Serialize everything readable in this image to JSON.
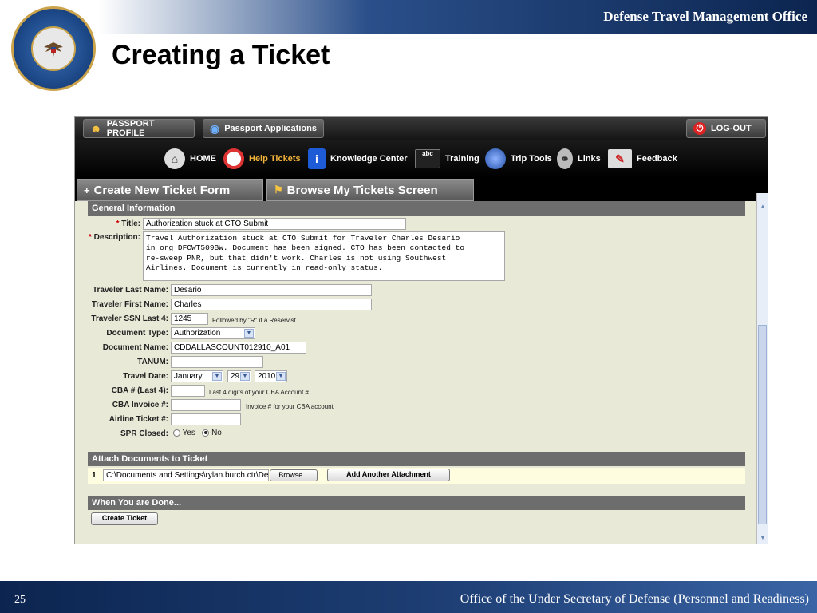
{
  "slide": {
    "org_name": "Defense Travel Management Office",
    "title": "Creating a Ticket",
    "page_number": "25",
    "footer": "Office of the Under Secretary of Defense (Personnel and Readiness)",
    "seal_text": [
      "Defense Travel Management Office",
      "Department of Defense"
    ]
  },
  "app": {
    "top_nav": {
      "passport_profile": "PASSPORT PROFILE",
      "passport_applications": "Passport Applications",
      "logout": "LOG-OUT"
    },
    "main_nav": [
      {
        "label": "HOME",
        "icon": "home-icon"
      },
      {
        "label": "Help Tickets",
        "icon": "lifebuoy-icon"
      },
      {
        "label": "Knowledge Center",
        "icon": "info-icon"
      },
      {
        "label": "Training",
        "icon": "terminal-icon"
      },
      {
        "label": "Trip Tools",
        "icon": "globe-icon"
      },
      {
        "label": "Links",
        "icon": "chain-icon"
      },
      {
        "label": "Feedback",
        "icon": "book-pencil-icon"
      }
    ],
    "terminal_icon_text": "abc",
    "tabs": {
      "create": "Create New Ticket Form",
      "browse": "Browse My Tickets Screen"
    },
    "sections": {
      "general": "General Information",
      "attach": "Attach Documents to Ticket",
      "done": "When You are Done..."
    },
    "form": {
      "title_label": "Title:",
      "title_value": "Authorization stuck at CTO Submit",
      "description_label": "Description:",
      "description_value": "Travel Authorization stuck at CTO Submit for Traveler Charles Desario\nin org DFCWT509BW. Document has been signed. CTO has been contacted to\nre-sweep PNR, but that didn't work. Charles is not using Southwest\nAirlines. Document is currently in read-only status.",
      "last_name_label": "Traveler Last Name:",
      "last_name_value": "Desario",
      "first_name_label": "Traveler First Name:",
      "first_name_value": "Charles",
      "ssn_label": "Traveler SSN Last 4:",
      "ssn_value": "1245",
      "ssn_hint": "Followed by \"R\" if a Reservist",
      "doc_type_label": "Document Type:",
      "doc_type_value": "Authorization",
      "doc_name_label": "Document Name:",
      "doc_name_value": "CDDALLASCOUNT012910_A01",
      "tanum_label": "TANUM:",
      "tanum_value": "",
      "travel_date_label": "Travel Date:",
      "travel_month": "January",
      "travel_day": "29",
      "travel_year": "2010",
      "cba_label": "CBA # (Last 4):",
      "cba_value": "",
      "cba_hint": "Last 4 digits of your CBA Account #",
      "cba_invoice_label": "CBA Invoice #:",
      "cba_invoice_value": "",
      "cba_invoice_hint": "Invoice # for your CBA account",
      "airline_label": "Airline Ticket #:",
      "airline_value": "",
      "spr_label": "SPR Closed:",
      "spr_yes": "Yes",
      "spr_no": "No",
      "spr_selected": "No"
    },
    "attach": {
      "row_number": "1",
      "file_path": "C:\\Documents and Settings\\rylan.burch.ctr\\Des",
      "browse_button": "Browse...",
      "add_button": "Add Another Attachment"
    },
    "create_button": "Create Ticket"
  }
}
